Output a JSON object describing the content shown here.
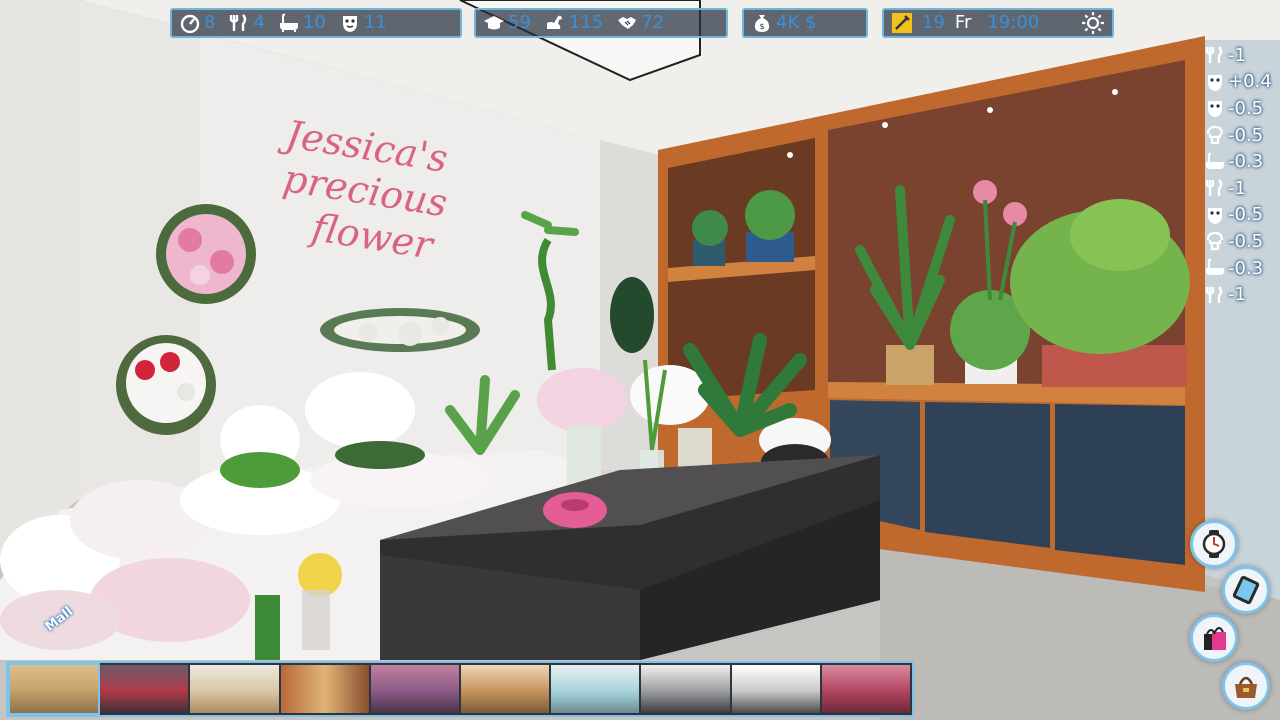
{
  "hud": {
    "energy": "8",
    "hunger": "4",
    "hygiene": "10",
    "mood": "11",
    "education": "59",
    "fitness": "115",
    "social": "72",
    "money": "4K $",
    "day": "19",
    "weekday": "Fr",
    "time": "19:00"
  },
  "sign": {
    "line1": "Jessica's",
    "line2": "precious",
    "line3": "flower"
  },
  "stat_changes": [
    {
      "icon": "fork-knife-icon",
      "value": "-1"
    },
    {
      "icon": "mask-icon",
      "value": "+0.4"
    },
    {
      "icon": "mask-icon",
      "value": "-0.5"
    },
    {
      "icon": "toilet-icon",
      "value": "-0.5"
    },
    {
      "icon": "bath-icon",
      "value": "-0.3"
    },
    {
      "icon": "fork-knife-icon",
      "value": "-1"
    },
    {
      "icon": "mask-icon",
      "value": "-0.5"
    },
    {
      "icon": "toilet-icon",
      "value": "-0.5"
    },
    {
      "icon": "bath-icon",
      "value": "-0.3"
    },
    {
      "icon": "fork-knife-icon",
      "value": "-1"
    }
  ],
  "location_label": "Mall",
  "colors": {
    "accent": "#7ec3ea",
    "hud_value": "#3b8fd6",
    "sign": "#d9647f"
  }
}
